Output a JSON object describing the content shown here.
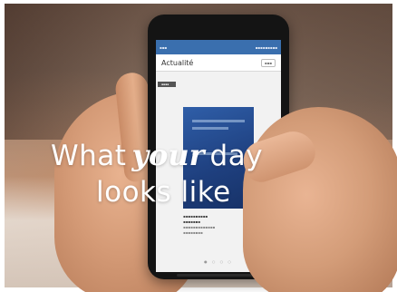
{
  "headline": {
    "word1": "What",
    "word2": "your",
    "word3": "day",
    "line2": "looks like"
  },
  "phone_screen": {
    "section_title": "Actualité"
  }
}
